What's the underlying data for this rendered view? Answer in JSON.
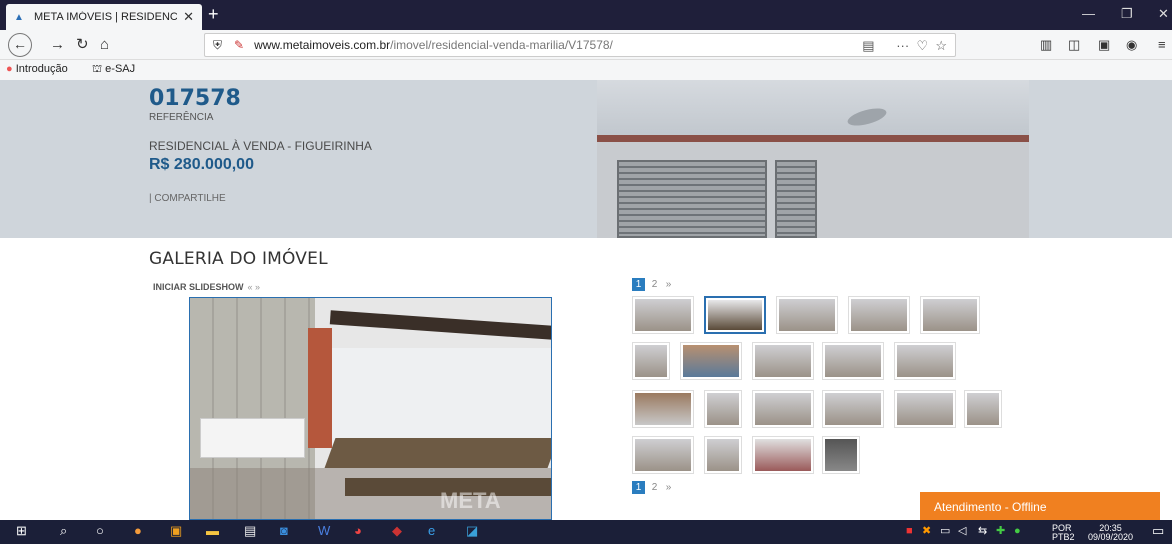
{
  "browser": {
    "tab_title": "META IMÓVEIS | RESIDENCIAL /",
    "tab_close": "✕",
    "new_tab": "+",
    "url_domain": "www.metaimoveis.com.br",
    "url_path": "/imovel/residencial-venda-marilia/V17578/",
    "url_dots": "···",
    "bookmarks": [
      "Introdução",
      "e-SAJ"
    ]
  },
  "property": {
    "code": "017578",
    "code_label": "REFERÊNCIA",
    "type": "RESIDENCIAL À VENDA - FIGUEIRINHA",
    "price": "R$ 280.000,00",
    "share": "| COMPARTILHE"
  },
  "gallery": {
    "title": "GALERIA DO IMÓVEL",
    "slideshow_label": "INICIAR SLIDESHOW",
    "slideshow_arrows": "« »",
    "pages": [
      "1",
      "2"
    ],
    "next": "»",
    "watermark": "META",
    "thumb_counts": [
      5,
      5,
      6,
      4
    ]
  },
  "chat": {
    "label": "Atendimento - Offline"
  },
  "taskbar": {
    "lang_top": "POR",
    "lang_bottom": "PTB2",
    "time": "20:35",
    "date": "09/09/2020"
  }
}
